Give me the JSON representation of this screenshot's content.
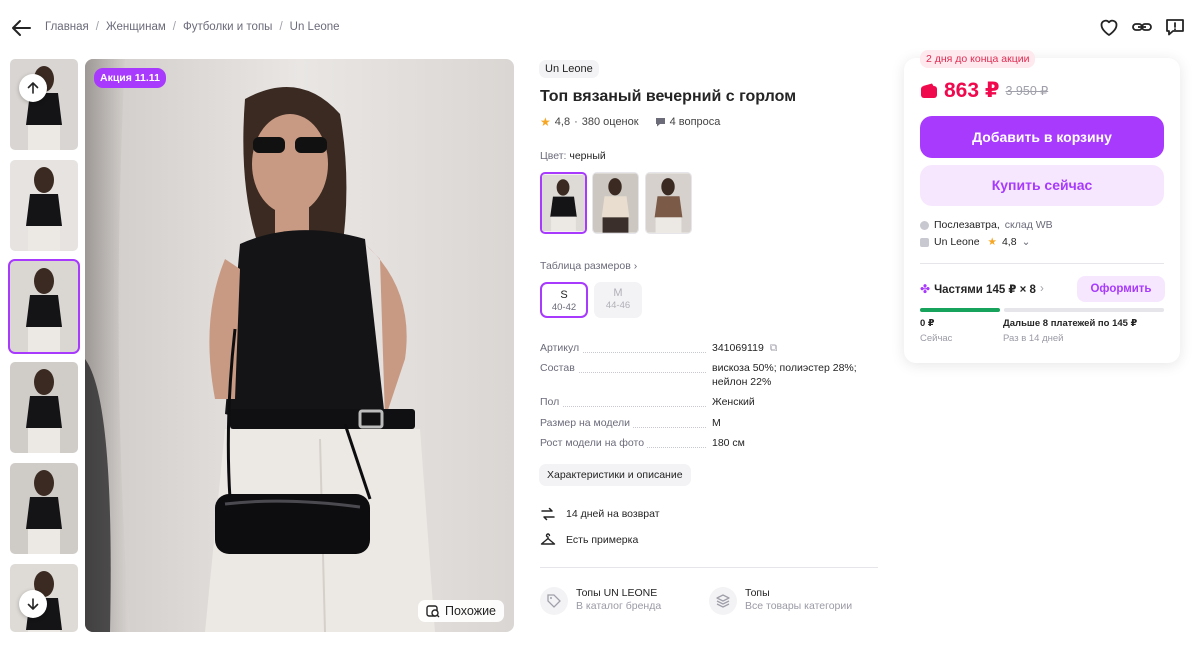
{
  "breadcrumbs": [
    "Главная",
    "Женщинам",
    "Футболки и топы",
    "Un Leone"
  ],
  "top_icons": [
    "heart-icon",
    "link-icon",
    "report-icon"
  ],
  "gallery": {
    "promo_badge": "Акция 11.11",
    "similar_label": "Похожие",
    "thumbnail_count": 6,
    "active_thumbnail": 3
  },
  "product": {
    "brand": "Un Leone",
    "title": "Топ вязаный вечерний с горлом",
    "rating": "4,8",
    "reviews": "380 оценок",
    "questions": "4 вопроса",
    "color_label": "Цвет:",
    "color_value": "черный",
    "colors": [
      "черный",
      "бежевый",
      "коричневый"
    ],
    "size_table_label": "Таблица размеров",
    "sizes": [
      {
        "label": "S",
        "range": "40-42",
        "available": true,
        "selected": true
      },
      {
        "label": "M",
        "range": "44-46",
        "available": false,
        "selected": false
      }
    ],
    "specs": [
      {
        "key": "Артикул",
        "value": "341069119"
      },
      {
        "key": "Состав",
        "value": "вискоза 50%; полиэстер 28%; нейлон 22%"
      },
      {
        "key": "Пол",
        "value": "Женский"
      },
      {
        "key": "Размер на модели",
        "value": "M"
      },
      {
        "key": "Рост модели на фото",
        "value": "180 см"
      }
    ],
    "chars_button": "Характеристики и описание",
    "features": [
      {
        "icon": "return-icon",
        "text": "14 дней на возврат"
      },
      {
        "icon": "hanger-icon",
        "text": "Есть примерка"
      }
    ],
    "links": [
      {
        "icon": "tag-icon",
        "title": "Топы UN LEONE",
        "subtitle": "В каталог бренда"
      },
      {
        "icon": "stack-icon",
        "title": "Топы",
        "subtitle": "Все товары категории"
      }
    ]
  },
  "buy": {
    "deadline": "2 дня до конца акции",
    "price": "863 ₽",
    "old_price": "3 950 ₽",
    "add_to_cart": "Добавить в корзину",
    "buy_now": "Купить сейчас",
    "delivery_day": "Послезавтра,",
    "delivery_warehouse": "склад WB",
    "seller": "Un Leone",
    "seller_rating": "4,8",
    "installments": "Частями 145 ₽ × 8",
    "order_button": "Оформить",
    "now_amount": "0 ₽",
    "now_label": "Сейчас",
    "later_amount": "Дальше 8 платежей по 145 ₽",
    "later_label": "Раз в 14 дней",
    "colors": {
      "accent": "#a73afd",
      "price": "#f0094d",
      "progress": "#17a35b"
    }
  }
}
